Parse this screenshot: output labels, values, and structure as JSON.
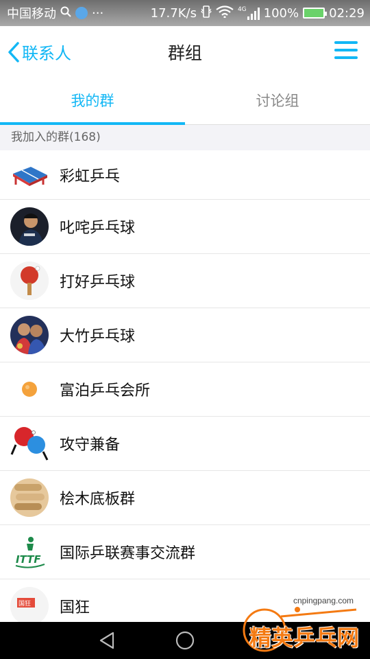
{
  "status_bar": {
    "carrier": "中国移动",
    "speed": "17.7K/s",
    "network": "4G",
    "battery": "100%",
    "time": "02:29",
    "dots": "···"
  },
  "nav": {
    "back_label": "联系人",
    "title": "群组"
  },
  "tabs": [
    {
      "label": "我的群",
      "active": true
    },
    {
      "label": "讨论组",
      "active": false
    }
  ],
  "section_header": "我加入的群(168)",
  "groups": [
    {
      "name": "彩虹乒乓",
      "icon": "ping-pong-table-icon"
    },
    {
      "name": "叱咤乒乓球",
      "icon": "player-photo-avatar"
    },
    {
      "name": "打好乒乓球",
      "icon": "paddle-icon"
    },
    {
      "name": "大竹乒乓球",
      "icon": "players-photo-avatar"
    },
    {
      "name": "富泊乒乓会所",
      "icon": "orange-ball-icon"
    },
    {
      "name": "攻守兼备",
      "icon": "two-paddles-icon"
    },
    {
      "name": "桧木底板群",
      "icon": "wood-blades-avatar"
    },
    {
      "name": "国际乒联赛事交流群",
      "icon": "ittf-logo-icon"
    },
    {
      "name": "国狂",
      "icon": "guokuang-logo-avatar"
    }
  ],
  "watermark": {
    "url": "cnpingpang.com",
    "text": "精英乒乓网"
  },
  "colors": {
    "accent": "#12b7f5",
    "section_bg": "#f3f3f7",
    "divider": "#e6e6e6"
  }
}
